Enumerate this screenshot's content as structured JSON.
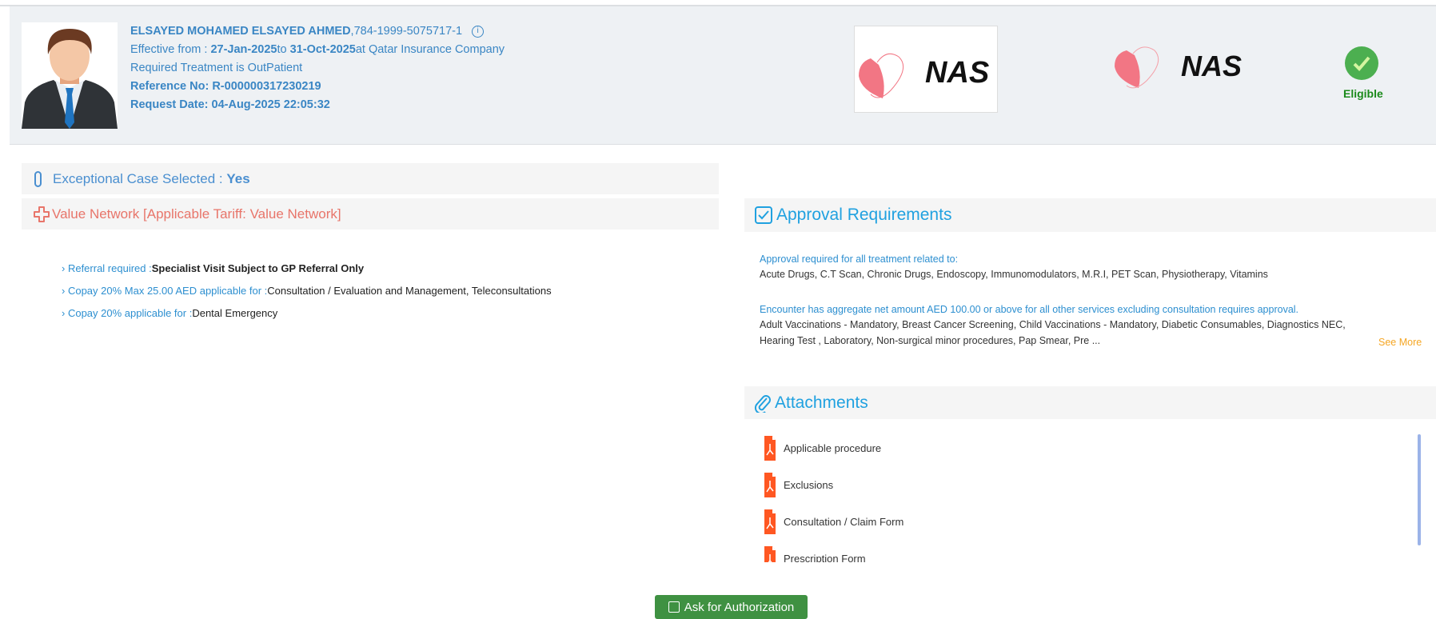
{
  "member": {
    "name": "ELSAYED MOHAMED ELSAYED AHMED",
    "id": ",784-1999-5075717-1",
    "effective_label": "Effective from : ",
    "from": "27-Jan-2025",
    "to_label": "to ",
    "to": "31-Oct-2025",
    "at_label": "at Qatar Insurance Company",
    "treatment": "Required Treatment is OutPatient",
    "reference": "Reference No: R-000000317230219",
    "request_date": "Request Date: 04-Aug-2025 22:05:32"
  },
  "logos": {
    "payer": "NAS",
    "tpa": "NAS"
  },
  "eligibility": {
    "status": "Eligible",
    "color": "#4caf50"
  },
  "exceptional": {
    "label": "Exceptional Case Selected : ",
    "value": "Yes"
  },
  "network": {
    "label": "Value Network [Applicable Tariff: Value Network]"
  },
  "benefits": [
    {
      "key": "Referral required :",
      "value": "Specialist Visit Subject to GP Referral Only"
    },
    {
      "key": "Copay 20% Max 25.00 AED applicable for :",
      "value": "Consultation / Evaluation and Management, Teleconsultations"
    },
    {
      "key": "Copay 20% applicable for :",
      "value": "Dental Emergency"
    }
  ],
  "approval": {
    "title": "Approval Requirements",
    "heading1": "Approval required for all treatment related to:",
    "list1": "Acute Drugs, C.T Scan, Chronic Drugs, Endoscopy, Immunomodulators, M.R.I, PET Scan, Physiotherapy, Vitamins",
    "heading2": "Encounter has aggregate net amount AED 100.00 or above for all other services excluding consultation requires approval.",
    "list2a": "Adult Vaccinations - Mandatory, Breast Cancer Screening, Child Vaccinations - Mandatory, Diabetic Consumables, Diagnostics NEC,",
    "list2b": "Hearing Test , Laboratory, Non-surgical minor procedures, Pap Smear, Pre ...",
    "see_more": "See More"
  },
  "attachments": {
    "title": "Attachments",
    "items": [
      "Applicable procedure",
      "Exclusions",
      "Consultation / Claim Form",
      "Prescription Form"
    ]
  },
  "actions": {
    "ask_auth": "Ask for Authorization"
  }
}
